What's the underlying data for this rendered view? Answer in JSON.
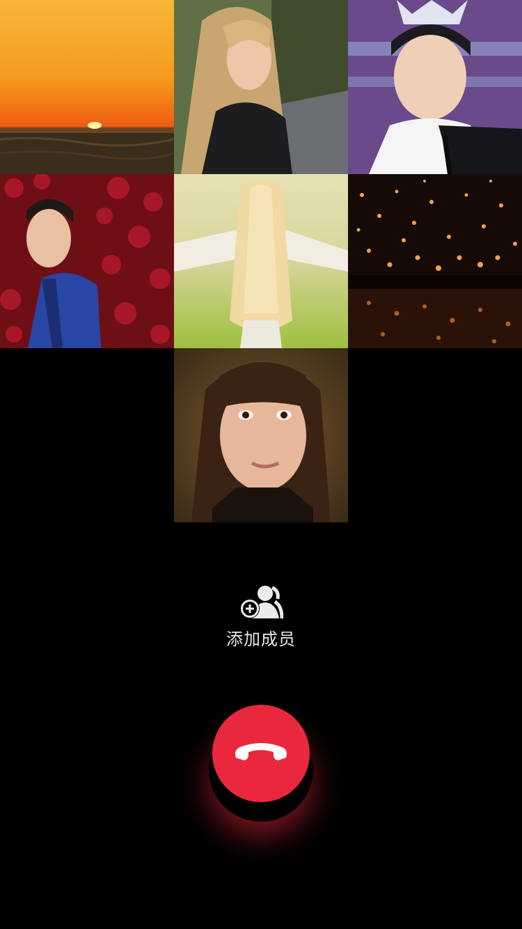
{
  "participants": [
    {
      "name": "participant-1-sunset",
      "kind": "sunset"
    },
    {
      "name": "participant-2-blonde-woman",
      "kind": "portrait"
    },
    {
      "name": "participant-3-man-with-crown",
      "kind": "portrait"
    },
    {
      "name": "participant-4-man-roses",
      "kind": "portrait"
    },
    {
      "name": "participant-5-girl-field",
      "kind": "portrait"
    },
    {
      "name": "participant-6-lanterns",
      "kind": "scene"
    },
    {
      "name": "participant-7-girl-braids",
      "kind": "portrait"
    }
  ],
  "actions": {
    "add_member_label": "添加成员",
    "add_member_icon": "add-group-icon",
    "hangup_icon": "hang-up-phone-icon"
  },
  "colors": {
    "background": "#000000",
    "hangup": "#e9283d",
    "label": "#e8e8e8"
  }
}
